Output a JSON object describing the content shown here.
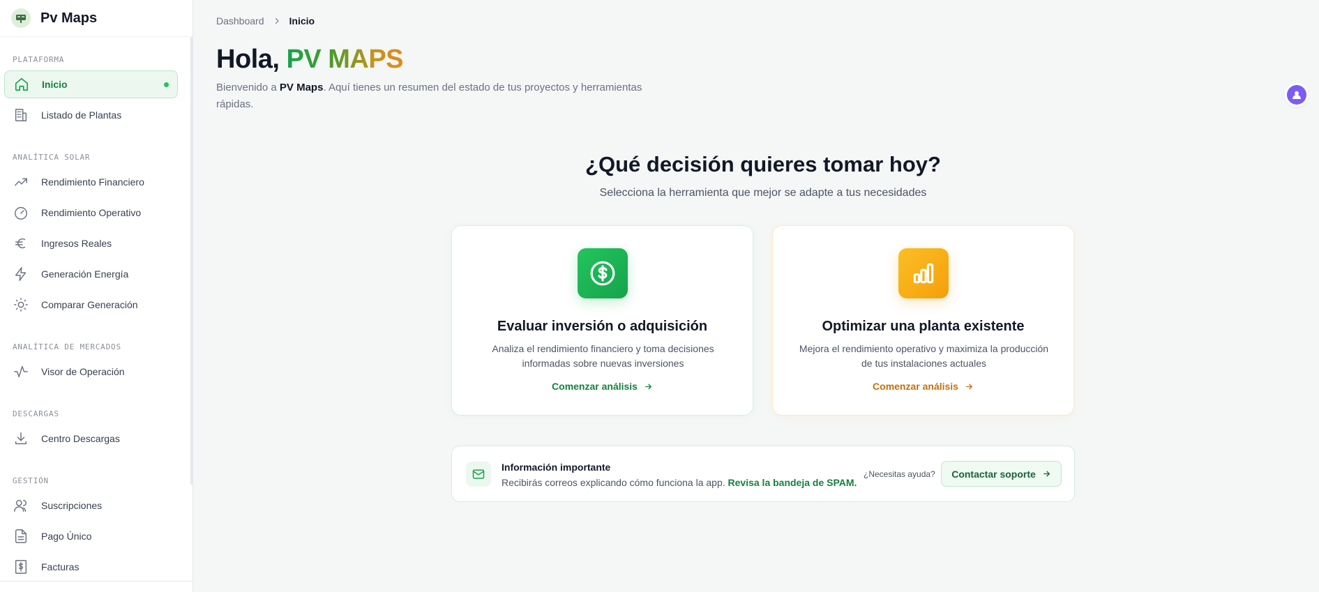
{
  "app": {
    "name": "Pv Maps"
  },
  "sidebar": {
    "sections": [
      {
        "title": "PLATAFORMA"
      },
      {
        "title": "ANALÍTICA SOLAR"
      },
      {
        "title": "ANALÍTICA DE MERCADOS"
      },
      {
        "title": "DESCARGAS"
      },
      {
        "title": "GESTIÓN"
      }
    ],
    "items": [
      {
        "label": "Inicio",
        "icon": "home-icon",
        "active": true
      },
      {
        "label": "Listado de Plantas",
        "icon": "building-icon"
      },
      {
        "label": "Rendimiento Financiero",
        "icon": "trending-up-icon"
      },
      {
        "label": "Rendimiento Operativo",
        "icon": "gauge-icon"
      },
      {
        "label": "Ingresos Reales",
        "icon": "euro-icon"
      },
      {
        "label": "Generación Energía",
        "icon": "zap-icon"
      },
      {
        "label": "Comparar Generación",
        "icon": "sun-icon"
      },
      {
        "label": "Visor de Operación",
        "icon": "activity-icon"
      },
      {
        "label": "Centro Descargas",
        "icon": "download-icon"
      },
      {
        "label": "Suscripciones",
        "icon": "users-icon"
      },
      {
        "label": "Pago Único",
        "icon": "file-icon"
      },
      {
        "label": "Facturas",
        "icon": "receipt-dollar-icon"
      }
    ]
  },
  "breadcrumb": {
    "root": "Dashboard",
    "current": "Inicio"
  },
  "greeting": {
    "prefix": "Hola,",
    "name": "PV MAPS"
  },
  "welcome": {
    "before": "Bienvenido a ",
    "brand": "PV Maps",
    "after": ". Aquí tienes un resumen del estado de tus proyectos y herramientas rápidas."
  },
  "decision": {
    "title": "¿Qué decisión quieres tomar hoy?",
    "subtitle": "Selecciona la herramienta que mejor se adapte a tus necesidades"
  },
  "cards": [
    {
      "title": "Evaluar inversión o adquisición",
      "description": "Analiza el rendimiento financiero y toma decisiones informadas sobre nuevas inversiones",
      "link": "Comenzar análisis",
      "icon": "dollar-circle-icon",
      "accent": "#16a34a"
    },
    {
      "title": "Optimizar una planta existente",
      "description": "Mejora el rendimiento operativo y maximiza la producción de tus instalaciones actuales",
      "link": "Comenzar análisis",
      "icon": "bar-chart-icon",
      "accent": "#f59e0b"
    }
  ],
  "info": {
    "title": "Información importante",
    "text": "Recibirás correos explicando cómo funciona la app. ",
    "highlight": "Revisa la bandeja de SPAM.",
    "help": "¿Necesitas ayuda?",
    "button": "Contactar soporte"
  },
  "colors": {
    "brand_green": "#16a34a",
    "brand_amber": "#f59e0b",
    "avatar": "#7c5cf5"
  }
}
